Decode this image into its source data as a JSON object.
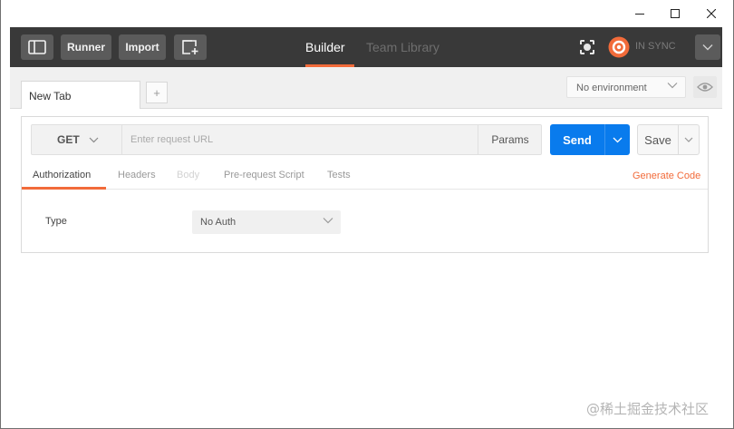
{
  "window_controls": [
    "minimize",
    "maximize",
    "close"
  ],
  "header": {
    "runner_label": "Runner",
    "import_label": "Import",
    "nav_builder": "Builder",
    "nav_team_library": "Team Library",
    "sync_status": "IN SYNC",
    "accent_color": "#f26b3a"
  },
  "tabs": {
    "items": [
      {
        "label": "New Tab"
      }
    ],
    "new_tab_symbol": "+",
    "environment": "No environment"
  },
  "request": {
    "method": "GET",
    "url_placeholder": "Enter request URL",
    "params_label": "Params",
    "send_label": "Send",
    "save_label": "Save",
    "send_color": "#097bed"
  },
  "subtabs": {
    "items": [
      {
        "label": "Authorization",
        "state": "active"
      },
      {
        "label": "Headers",
        "state": "inactive"
      },
      {
        "label": "Body",
        "state": "disabled"
      },
      {
        "label": "Pre-request Script",
        "state": "inactive"
      },
      {
        "label": "Tests",
        "state": "inactive"
      }
    ],
    "generate_code": "Generate Code"
  },
  "auth": {
    "type_label": "Type",
    "type_value": "No Auth"
  },
  "watermark": "@稀土掘金技术社区"
}
